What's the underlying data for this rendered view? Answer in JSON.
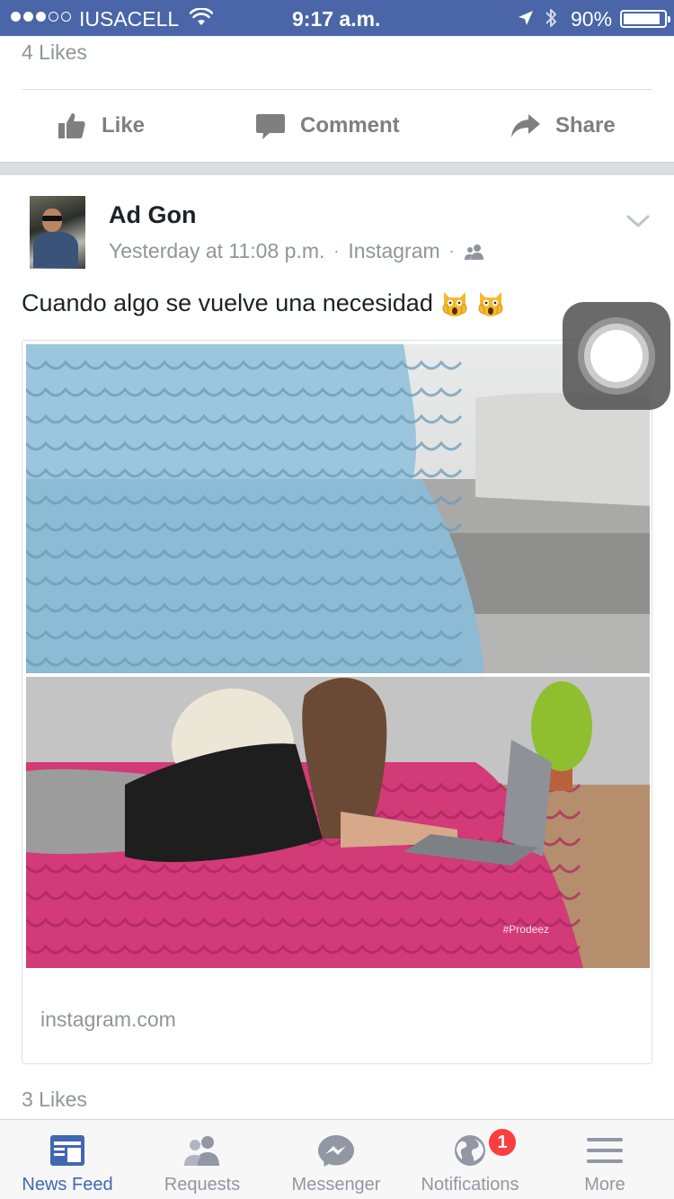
{
  "status_bar": {
    "carrier": "IUSACELL",
    "time": "9:17 a.m.",
    "battery_percent": "90%",
    "battery_level": 0.9,
    "signal_bars_filled": 3,
    "signal_bars_total": 5
  },
  "previous_post": {
    "likes": "4 Likes"
  },
  "action_bar": {
    "like_label": "Like",
    "comment_label": "Comment",
    "share_label": "Share"
  },
  "post": {
    "author": "Ad Gon",
    "timestamp": "Yesterday at 11:08 p.m.",
    "separator": "·",
    "via": "Instagram",
    "text": "Cuando algo se vuelve una necesidad",
    "emojis": [
      "scream-cat-emoji",
      "scream-cat-emoji"
    ],
    "link": {
      "domain": "instagram.com",
      "photo_credit": "#Prodeez"
    },
    "likes": "3 Likes"
  },
  "tab_bar": {
    "tabs": [
      {
        "label": "News Feed",
        "icon": "news-feed-icon",
        "active": true
      },
      {
        "label": "Requests",
        "icon": "requests-icon",
        "active": false
      },
      {
        "label": "Messenger",
        "icon": "messenger-icon",
        "active": false
      },
      {
        "label": "Notifications",
        "icon": "globe-icon",
        "active": false,
        "badge": "1"
      },
      {
        "label": "More",
        "icon": "menu-icon",
        "active": false
      }
    ]
  },
  "colors": {
    "brand": "#4a66a8",
    "active_tab": "#4267b2",
    "badge": "#fa3e3e"
  }
}
